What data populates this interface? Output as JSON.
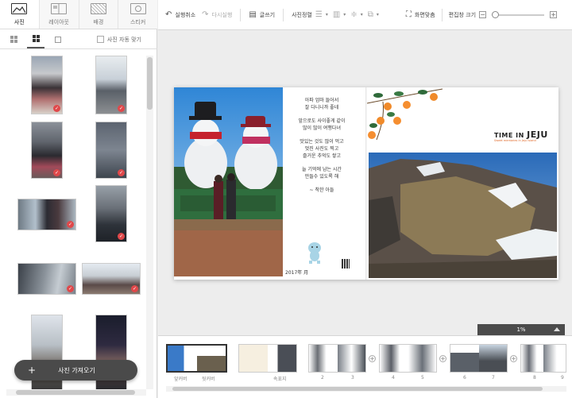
{
  "left_panel": {
    "tabs": [
      {
        "label": "사진",
        "icon": "photo-tab-icon",
        "active": true
      },
      {
        "label": "레이아웃",
        "icon": "layout-tab-icon",
        "active": false
      },
      {
        "label": "배경",
        "icon": "background-tab-icon",
        "active": false
      },
      {
        "label": "스티커",
        "icon": "sticker-tab-icon",
        "active": false
      }
    ],
    "auto_fit_label": "사진 자동 맞기",
    "get_photos_label": "사진 가져오기",
    "used_check": "✓"
  },
  "toolbar": {
    "undo": "실행취소",
    "redo": "다시실행",
    "textbox": "글쓰기",
    "photo_align": "사진정렬",
    "fit_screen": "화면맞춤",
    "edit_zoom": "편집창 크기",
    "zoom_minus": "−",
    "zoom_plus": "+"
  },
  "spread": {
    "poem": [
      "아파 엄마 들어서\n잘 다니니까 좋네",
      "앞으로도 사이좋게 같이\n많이 많이 여행다녀",
      "맛있는 것도 많이 먹고\n멋진 사진도 찍고\n즐거운 추억도 쌓고",
      "늘 기억에 남는 시간\n만들수 있도록 해",
      "~ 착한 아들"
    ],
    "date": "2017年 月",
    "title_small": "TIME IN",
    "title_big": "JEJU",
    "subtitle": "Sweet memories in Jeju Island"
  },
  "zoom_percent": "1%",
  "page_strip": [
    {
      "label_left": "앞커버",
      "label_right": "뒷커버"
    },
    {
      "label_left": "속표지",
      "label_right": ""
    },
    {
      "label_left": "2",
      "label_right": "3"
    },
    {
      "label_left": "4",
      "label_right": "5"
    },
    {
      "label_left": "6",
      "label_right": "7"
    },
    {
      "label_left": "8",
      "label_right": "9"
    }
  ],
  "colors": {
    "accent_check": "#e0484a",
    "button_dark": "#4a4a4a"
  }
}
